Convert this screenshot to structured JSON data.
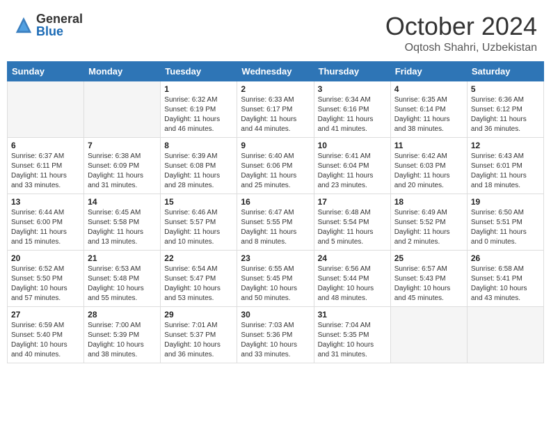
{
  "header": {
    "logo_general": "General",
    "logo_blue": "Blue",
    "month_title": "October 2024",
    "location": "Oqtosh Shahri, Uzbekistan"
  },
  "days_of_week": [
    "Sunday",
    "Monday",
    "Tuesday",
    "Wednesday",
    "Thursday",
    "Friday",
    "Saturday"
  ],
  "weeks": [
    [
      {
        "day": "",
        "empty": true
      },
      {
        "day": "",
        "empty": true
      },
      {
        "day": "1",
        "sunrise": "6:32 AM",
        "sunset": "6:19 PM",
        "daylight": "11 hours and 46 minutes."
      },
      {
        "day": "2",
        "sunrise": "6:33 AM",
        "sunset": "6:17 PM",
        "daylight": "11 hours and 44 minutes."
      },
      {
        "day": "3",
        "sunrise": "6:34 AM",
        "sunset": "6:16 PM",
        "daylight": "11 hours and 41 minutes."
      },
      {
        "day": "4",
        "sunrise": "6:35 AM",
        "sunset": "6:14 PM",
        "daylight": "11 hours and 38 minutes."
      },
      {
        "day": "5",
        "sunrise": "6:36 AM",
        "sunset": "6:12 PM",
        "daylight": "11 hours and 36 minutes."
      }
    ],
    [
      {
        "day": "6",
        "sunrise": "6:37 AM",
        "sunset": "6:11 PM",
        "daylight": "11 hours and 33 minutes."
      },
      {
        "day": "7",
        "sunrise": "6:38 AM",
        "sunset": "6:09 PM",
        "daylight": "11 hours and 31 minutes."
      },
      {
        "day": "8",
        "sunrise": "6:39 AM",
        "sunset": "6:08 PM",
        "daylight": "11 hours and 28 minutes."
      },
      {
        "day": "9",
        "sunrise": "6:40 AM",
        "sunset": "6:06 PM",
        "daylight": "11 hours and 25 minutes."
      },
      {
        "day": "10",
        "sunrise": "6:41 AM",
        "sunset": "6:04 PM",
        "daylight": "11 hours and 23 minutes."
      },
      {
        "day": "11",
        "sunrise": "6:42 AM",
        "sunset": "6:03 PM",
        "daylight": "11 hours and 20 minutes."
      },
      {
        "day": "12",
        "sunrise": "6:43 AM",
        "sunset": "6:01 PM",
        "daylight": "11 hours and 18 minutes."
      }
    ],
    [
      {
        "day": "13",
        "sunrise": "6:44 AM",
        "sunset": "6:00 PM",
        "daylight": "11 hours and 15 minutes."
      },
      {
        "day": "14",
        "sunrise": "6:45 AM",
        "sunset": "5:58 PM",
        "daylight": "11 hours and 13 minutes."
      },
      {
        "day": "15",
        "sunrise": "6:46 AM",
        "sunset": "5:57 PM",
        "daylight": "11 hours and 10 minutes."
      },
      {
        "day": "16",
        "sunrise": "6:47 AM",
        "sunset": "5:55 PM",
        "daylight": "11 hours and 8 minutes."
      },
      {
        "day": "17",
        "sunrise": "6:48 AM",
        "sunset": "5:54 PM",
        "daylight": "11 hours and 5 minutes."
      },
      {
        "day": "18",
        "sunrise": "6:49 AM",
        "sunset": "5:52 PM",
        "daylight": "11 hours and 2 minutes."
      },
      {
        "day": "19",
        "sunrise": "6:50 AM",
        "sunset": "5:51 PM",
        "daylight": "11 hours and 0 minutes."
      }
    ],
    [
      {
        "day": "20",
        "sunrise": "6:52 AM",
        "sunset": "5:50 PM",
        "daylight": "10 hours and 57 minutes."
      },
      {
        "day": "21",
        "sunrise": "6:53 AM",
        "sunset": "5:48 PM",
        "daylight": "10 hours and 55 minutes."
      },
      {
        "day": "22",
        "sunrise": "6:54 AM",
        "sunset": "5:47 PM",
        "daylight": "10 hours and 53 minutes."
      },
      {
        "day": "23",
        "sunrise": "6:55 AM",
        "sunset": "5:45 PM",
        "daylight": "10 hours and 50 minutes."
      },
      {
        "day": "24",
        "sunrise": "6:56 AM",
        "sunset": "5:44 PM",
        "daylight": "10 hours and 48 minutes."
      },
      {
        "day": "25",
        "sunrise": "6:57 AM",
        "sunset": "5:43 PM",
        "daylight": "10 hours and 45 minutes."
      },
      {
        "day": "26",
        "sunrise": "6:58 AM",
        "sunset": "5:41 PM",
        "daylight": "10 hours and 43 minutes."
      }
    ],
    [
      {
        "day": "27",
        "sunrise": "6:59 AM",
        "sunset": "5:40 PM",
        "daylight": "10 hours and 40 minutes."
      },
      {
        "day": "28",
        "sunrise": "7:00 AM",
        "sunset": "5:39 PM",
        "daylight": "10 hours and 38 minutes."
      },
      {
        "day": "29",
        "sunrise": "7:01 AM",
        "sunset": "5:37 PM",
        "daylight": "10 hours and 36 minutes."
      },
      {
        "day": "30",
        "sunrise": "7:03 AM",
        "sunset": "5:36 PM",
        "daylight": "10 hours and 33 minutes."
      },
      {
        "day": "31",
        "sunrise": "7:04 AM",
        "sunset": "5:35 PM",
        "daylight": "10 hours and 31 minutes."
      },
      {
        "day": "",
        "empty": true
      },
      {
        "day": "",
        "empty": true
      }
    ]
  ]
}
